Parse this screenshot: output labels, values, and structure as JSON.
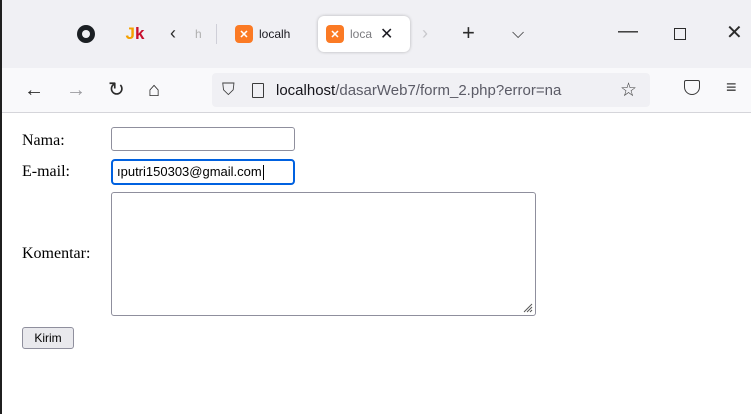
{
  "browser": {
    "tab_strip": {
      "partial_tab_fragment": "h",
      "tabs": [
        {
          "label": "localh",
          "icon": "xampp-icon",
          "active": false
        },
        {
          "label": "loca",
          "icon": "xampp-icon",
          "active": true
        }
      ]
    },
    "url": "localhost/dasarWeb7/form_2.php?error=na",
    "url_host": "localhost",
    "url_path": "/dasarWeb7/form_2.php?error=na"
  },
  "form": {
    "nama_label": "Nama:",
    "nama_value": "",
    "email_label": "E-mail:",
    "email_value": "ıputri150303@gmail.com",
    "komentar_label": "Komentar:",
    "komentar_value": "",
    "submit_label": "Kirim"
  },
  "colors": {
    "xampp_orange": "#fb7a24",
    "focus_ring": "#0061e0",
    "tabstrip_bg": "#f0f0f4"
  }
}
